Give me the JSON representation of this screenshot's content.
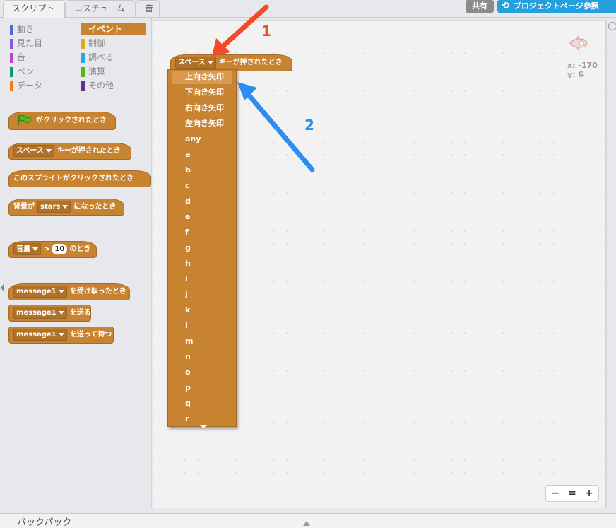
{
  "tabs": [
    {
      "label": "スクリプト"
    },
    {
      "label": "コスチューム"
    },
    {
      "label": "音"
    }
  ],
  "header": {
    "share_label": "共有",
    "project_page_label": "プロジェクトページ参照"
  },
  "categories": [
    {
      "label": "動き",
      "color": "#4a6cd4"
    },
    {
      "label": "見た目",
      "color": "#8a55d7"
    },
    {
      "label": "音",
      "color": "#bb42c3"
    },
    {
      "label": "ペン",
      "color": "#0e9a6c"
    },
    {
      "label": "データ",
      "color": "#ee7d16"
    },
    {
      "label": "イベント",
      "color": "#c88330"
    },
    {
      "label": "制御",
      "color": "#e1a91a"
    },
    {
      "label": "調べる",
      "color": "#2ca5e2"
    },
    {
      "label": "演算",
      "color": "#5cb712"
    },
    {
      "label": "その他",
      "color": "#632d99"
    }
  ],
  "palette_blocks": {
    "flag_clicked": "がクリックされたとき",
    "key_pressed_key": "スペース",
    "key_pressed_text": "キーが押されたとき",
    "sprite_clicked": "このスプライトがクリックされたとき",
    "backdrop_prefix": "背景が",
    "backdrop_value": "stars",
    "backdrop_suffix": "になったとき",
    "sensor_value": "音量",
    "sensor_op": ">",
    "sensor_num": "10",
    "sensor_suffix": "のとき",
    "receive_msg": "message1",
    "receive_text": "を受け取ったとき",
    "broadcast_msg": "message1",
    "broadcast_text": "を送る",
    "broadcast_wait_msg": "message1",
    "broadcast_wait_text": "を送って待つ"
  },
  "script_block": {
    "key": "スペース",
    "text": "キーが押されたとき"
  },
  "sprite_info": {
    "x_label": "x: -170",
    "y_label": "y: 6"
  },
  "key_menu": {
    "items": [
      "上向き矢印",
      "下向き矢印",
      "右向き矢印",
      "左向き矢印",
      "any",
      "a",
      "b",
      "c",
      "d",
      "e",
      "f",
      "g",
      "h",
      "i",
      "j",
      "k",
      "l",
      "m",
      "n",
      "o",
      "p",
      "q",
      "r"
    ]
  },
  "annotations": {
    "label_1": "1",
    "label_2": "2",
    "color_1": "#f44a2a",
    "color_2": "#2a8ef0"
  },
  "zoom": {
    "out": "−",
    "reset": "=",
    "in": "+"
  },
  "backpack": {
    "label": "バックパック"
  }
}
